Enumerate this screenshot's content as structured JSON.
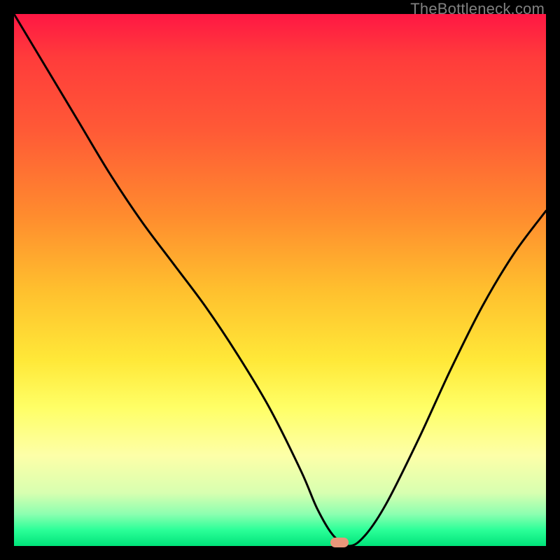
{
  "attribution": "TheBottleneck.com",
  "marker": {
    "x_frac": 0.612,
    "y_frac": 0.994
  },
  "chart_data": {
    "type": "line",
    "title": "",
    "xlabel": "",
    "ylabel": "",
    "xlim": [
      0,
      100
    ],
    "ylim": [
      0,
      100
    ],
    "series": [
      {
        "name": "bottleneck-curve",
        "x": [
          0,
          6,
          12,
          18,
          24,
          30,
          36,
          42,
          48,
          54,
          57,
          60,
          63,
          66,
          70,
          76,
          82,
          88,
          94,
          100
        ],
        "y": [
          100,
          90,
          80,
          70,
          61,
          53,
          45,
          36,
          26,
          14,
          7,
          2,
          0,
          2,
          8,
          20,
          33,
          45,
          55,
          63
        ]
      }
    ],
    "annotations": [
      {
        "type": "marker",
        "shape": "pill",
        "color": "#e9967a",
        "x": 61.2,
        "y": 0.6
      }
    ],
    "background_gradient": {
      "direction": "top-to-bottom",
      "stops": [
        {
          "pos": 0.0,
          "color": "#ff1744"
        },
        {
          "pos": 0.38,
          "color": "#ff8c2e"
        },
        {
          "pos": 0.65,
          "color": "#ffe838"
        },
        {
          "pos": 0.9,
          "color": "#d8ffb0"
        },
        {
          "pos": 1.0,
          "color": "#00e37a"
        }
      ]
    }
  }
}
